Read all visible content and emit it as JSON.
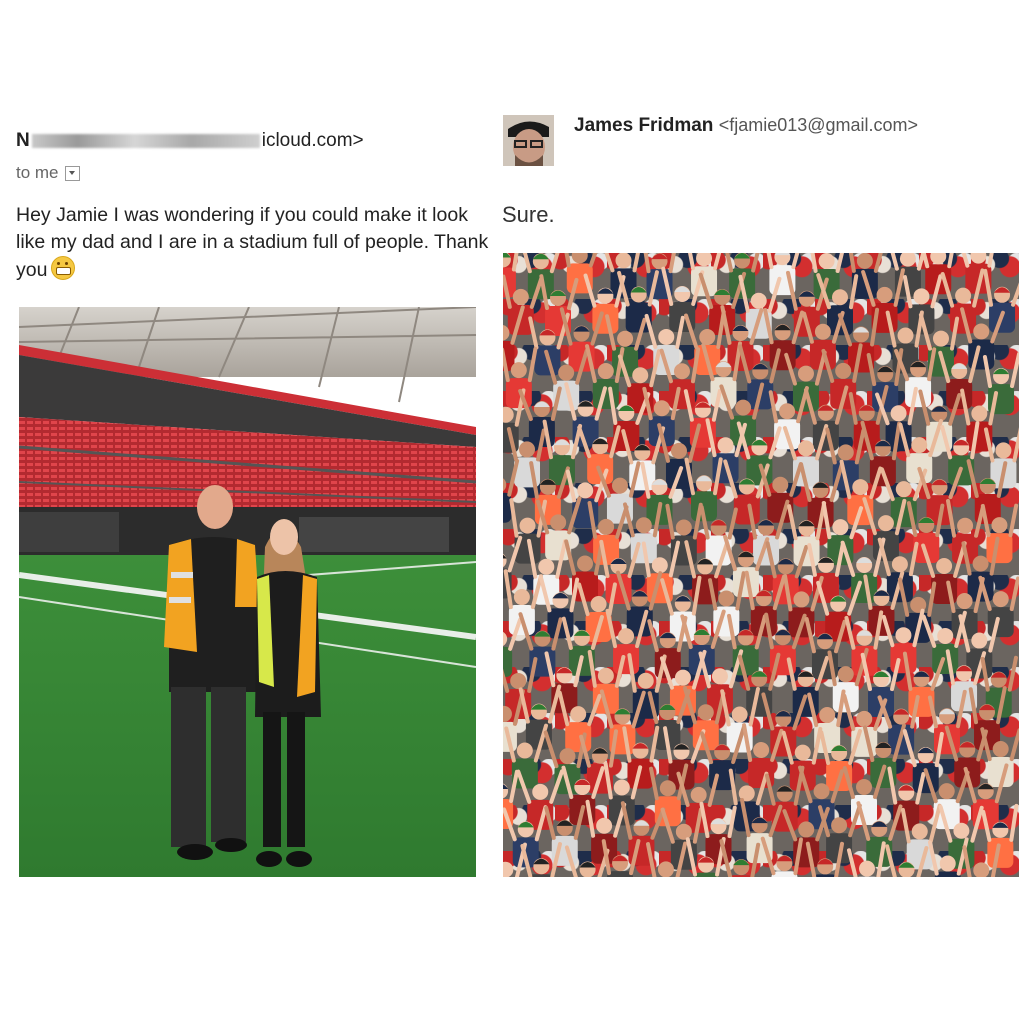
{
  "left_email": {
    "sender_initial": "N",
    "sender_domain": "icloud.com>",
    "recipient_label": "to me",
    "message": "Hey Jamie I was wondering if you could make it look like my dad and I are in a stadium full of people. Thank you"
  },
  "right_email": {
    "sender_name": "James Fridman",
    "sender_email": "<fjamie013@gmail.com>",
    "reply": "Sure."
  },
  "colors": {
    "seat_red": "#d9363e",
    "turf_green": "#3f9a3a",
    "vest_orange": "#f2a321",
    "vest_yellow": "#d7e84a"
  }
}
